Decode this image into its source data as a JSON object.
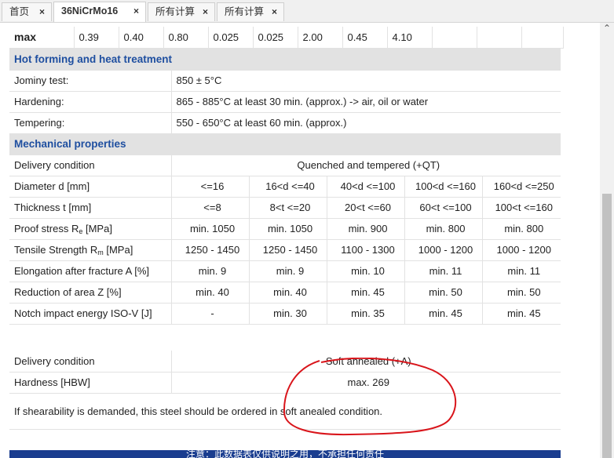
{
  "tabs": [
    {
      "label": "首页",
      "close": "×"
    },
    {
      "label": "36NiCrMo16",
      "close": "×"
    },
    {
      "label": "所有计算",
      "close": "×"
    },
    {
      "label": "所有计算",
      "close": "×"
    }
  ],
  "composition_max": {
    "label": "max",
    "values": [
      "0.39",
      "0.40",
      "0.80",
      "0.025",
      "0.025",
      "2.00",
      "0.45",
      "4.10",
      "",
      "",
      ""
    ]
  },
  "hot_forming": {
    "title": "Hot forming and heat treatment",
    "rows": [
      {
        "label": "Jominy test:",
        "value": "850 ± 5°C"
      },
      {
        "label": "Hardening:",
        "value": "865 - 885°C at least 30 min. (approx.) -> air, oil or water"
      },
      {
        "label": "Tempering:",
        "value": "550 - 650°C at least 60 min. (approx.)"
      }
    ]
  },
  "mechanical": {
    "title": "Mechanical properties",
    "delivery_label": "Delivery condition",
    "delivery_value": "Quenched and tempered (+QT)",
    "rows": [
      {
        "label": "Diameter d [mm]",
        "values": [
          "<=16",
          "16<d <=40",
          "40<d <=100",
          "100<d <=160",
          "160<d <=250"
        ]
      },
      {
        "label": "Thickness t [mm]",
        "values": [
          "<=8",
          "8<t <=20",
          "20<t <=60",
          "60<t <=100",
          "100<t <=160"
        ]
      },
      {
        "label_main": "Proof stress R",
        "label_sub": "e",
        "label_tail": " [MPa]",
        "values": [
          "min. 1050",
          "min. 1050",
          "min. 900",
          "min. 800",
          "min. 800"
        ]
      },
      {
        "label_main": "Tensile Strength R",
        "label_sub": "m",
        "label_tail": " [MPa]",
        "values": [
          "1250 - 1450",
          "1250 - 1450",
          "1100 - 1300",
          "1000 - 1200",
          "1000 - 1200"
        ]
      },
      {
        "label": "Elongation after fracture A [%]",
        "values": [
          "min. 9",
          "min. 9",
          "min. 10",
          "min. 11",
          "min. 11"
        ]
      },
      {
        "label": "Reduction of area Z [%]",
        "values": [
          "min. 40",
          "min. 40",
          "min. 45",
          "min. 50",
          "min. 50"
        ]
      },
      {
        "label": "Notch impact energy ISO-V [J]",
        "values": [
          "-",
          "min. 30",
          "min. 35",
          "min. 45",
          "min. 45"
        ]
      }
    ]
  },
  "soft_annealed": {
    "delivery_label": "Delivery condition",
    "delivery_value": "Soft annealed (+A)",
    "hardness_label": "Hardness [HBW]",
    "hardness_value": "max. 269",
    "note": "If shearability is demanded, this steel should be ordered in soft anealed condition."
  },
  "footer": {
    "text": "注意：此数据表仅供说明之用，不承担任何责任"
  },
  "annotation": {
    "color": "#d9151b"
  },
  "colors": {
    "section_header_text": "#1f4fa0",
    "section_header_bg": "#e2e2e2",
    "footer_bg": "#1a3d8f"
  }
}
